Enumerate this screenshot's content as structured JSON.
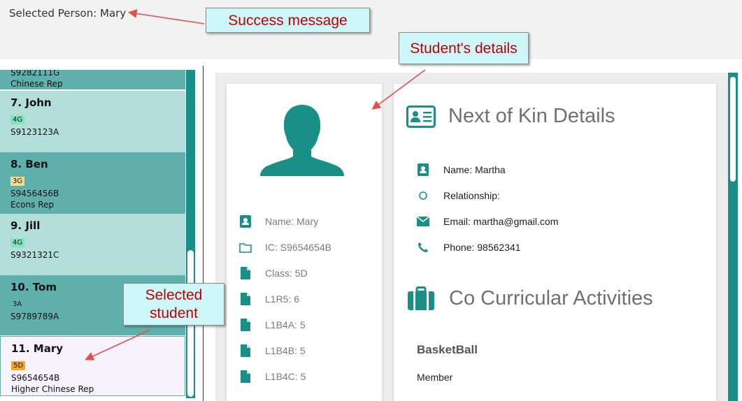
{
  "status": {
    "text": "Selected Person: Mary"
  },
  "list": {
    "partial_top": {
      "line1": "S9282111G",
      "line2": "Chinese Rep"
    },
    "cards": [
      {
        "name": "7.  John",
        "tag": "4G",
        "ic": "S9123123A",
        "role": ""
      },
      {
        "name": "8.  Ben",
        "tag": "3G",
        "ic": "S9456456B",
        "role": "Econs Rep"
      },
      {
        "name": "9.  Jill",
        "tag": "4G",
        "ic": "S9321321C",
        "role": ""
      },
      {
        "name": "10.  Tom",
        "tag": "3A",
        "ic": "S9789789A",
        "role": ""
      },
      {
        "name": "11.  Mary",
        "tag": "5D",
        "ic": "S9654654B",
        "role": "Higher Chinese Rep"
      }
    ]
  },
  "profile": {
    "rows": [
      {
        "icon": "contact-icon",
        "text": "Name: Mary"
      },
      {
        "icon": "folder-icon",
        "text": "IC: S9654654B"
      },
      {
        "icon": "file-icon",
        "text": "Class: 5D"
      },
      {
        "icon": "file-icon",
        "text": "L1R5: 6"
      },
      {
        "icon": "file-icon",
        "text": "L1B4A: 5"
      },
      {
        "icon": "file-icon",
        "text": "L1B4B: 5"
      },
      {
        "icon": "file-icon",
        "text": "L1B4C: 5"
      }
    ]
  },
  "kin": {
    "title": "Next of Kin Details",
    "rows": [
      {
        "icon": "contact-icon",
        "text": "Name: Martha"
      },
      {
        "icon": "circle-icon",
        "text": "Relationship:"
      },
      {
        "icon": "envelope-icon",
        "text": "Email: martha@gmail.com"
      },
      {
        "icon": "phone-icon",
        "text": "Phone: 98562341"
      }
    ]
  },
  "cca": {
    "title": "Co Curricular Activities",
    "activity": "BasketBall",
    "role": "Member"
  },
  "annotations": {
    "success": "Success message",
    "details": "Student's details",
    "selected_line1": "Selected",
    "selected_line2": "student"
  },
  "colors": {
    "teal": "#1a8f87",
    "card_dark": "#5fb0ad",
    "card_light": "#b3deda",
    "selected_bg": "#f7f2fc",
    "tag_4G": "#7de6c0",
    "tag_3G": "#f4dc8a",
    "tag_3A": "#5fb0ad",
    "tag_5D": "#f5a623",
    "callout_bg": "#ccf6f7",
    "callout_text": "#c00000",
    "arrow": "#e05050"
  }
}
